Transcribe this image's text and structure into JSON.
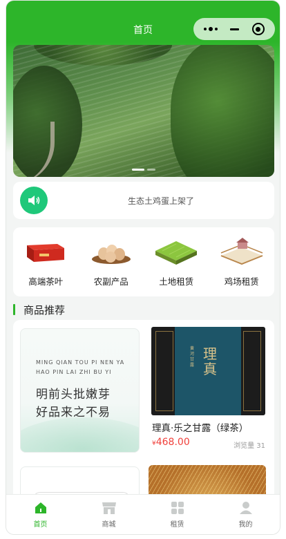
{
  "navbar": {
    "title": "首页"
  },
  "notice": {
    "text": "生态土鸡蛋上架了"
  },
  "categories": [
    {
      "label": "高端茶叶",
      "icon": "tea-box-icon"
    },
    {
      "label": "农副产品",
      "icon": "eggs-basket-icon"
    },
    {
      "label": "土地租赁",
      "icon": "land-plot-icon"
    },
    {
      "label": "鸡场租赁",
      "icon": "chicken-farm-icon"
    }
  ],
  "section": {
    "title": "商品推荐"
  },
  "products": [
    {
      "banner_pinyin_1": "MING QIAN TOU PI NEN YA",
      "banner_pinyin_2": "HAO PIN LAI ZHI BU YI",
      "banner_line_1": "明前头批嫩芽",
      "banner_line_2": "好品来之不易"
    },
    {
      "name": "理真·乐之甘露（绿茶）",
      "price_symbol": "¥",
      "price": "468.00",
      "views": "浏览量 31",
      "package_text_big": "理真",
      "package_text_small": "黄河甘露"
    }
  ],
  "tabbar": [
    {
      "label": "首页",
      "icon": "home-icon",
      "active": true
    },
    {
      "label": "商城",
      "icon": "shop-icon",
      "active": false
    },
    {
      "label": "租赁",
      "icon": "grid-icon",
      "active": false
    },
    {
      "label": "我的",
      "icon": "user-icon",
      "active": false
    }
  ],
  "colors": {
    "brand": "#2db52a",
    "price": "#f0403b",
    "notice_icon": "#1fc87a"
  }
}
